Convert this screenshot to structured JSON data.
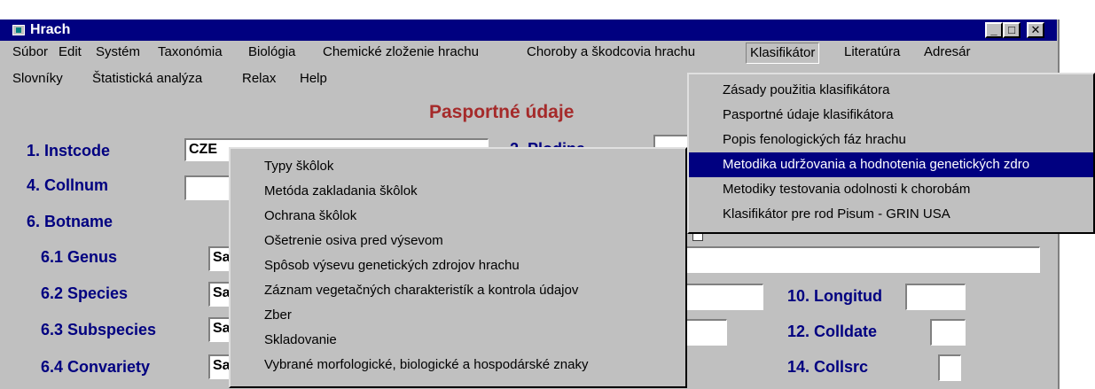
{
  "window": {
    "title": "Hrach",
    "min_glyph": "_",
    "max_glyph": "□",
    "close_glyph": "✕"
  },
  "menubar": {
    "row1": [
      "Súbor",
      "Edit",
      "Systém",
      "Taxonómia",
      "Biológia",
      "Chemické zloženie hrachu",
      "Choroby a škodcovia hrachu",
      "Klasifikátor",
      "Literatúra",
      "Adresár"
    ],
    "row2": [
      "Slovníky",
      "Štatistická analýza",
      "Relax",
      "Help"
    ]
  },
  "form": {
    "title": "Pasportné údaje",
    "labels": {
      "instcode": "1. Instcode",
      "plodina": "2. Plodina",
      "collnum": "4. Collnum",
      "botname": "6. Botname",
      "genus": "6.1 Genus",
      "species": "6.2 Species",
      "subspecies": "6.3 Subspecies",
      "convariety": "6.4 Convariety",
      "longitud": "10. Longitud",
      "colldate": "12. Colldate",
      "collsrc": "14. Collsrc"
    },
    "values": {
      "instcode": "CZE",
      "genus": "Sa",
      "species": "Sa",
      "subspecies": "Sa",
      "convariety": "Sa"
    }
  },
  "klasifikator_menu": [
    "Zásady použitia klasifikátora",
    "Pasportné údaje klasifikátora",
    "Popis fenologických fáz hrachu",
    "Metodika udržovania a hodnotenia genetických zdro",
    "Metodiky testovania odolnosti k chorobám",
    "Klasifikátor pre rod Pisum - GRIN USA"
  ],
  "metodika_submenu": [
    "Typy škôlok",
    "Metóda zakladania škôlok",
    "Ochrana škôlok",
    "Ošetrenie osiva pred výsevom",
    "Spôsob výsevu genetických zdrojov hrachu",
    "Záznam vegetačných charakteristík a kontrola údajov",
    "Zber",
    "Skladovanie",
    "Vybrané morfologické, biologické a hospodárské znaky"
  ],
  "colors": {
    "titlebar": "#000080",
    "face": "#c0c0c0",
    "label": "#000080",
    "form_title": "#a52a2a",
    "highlight": "#000080"
  },
  "icons": [
    "app-icon",
    "minimize-icon",
    "maximize-icon",
    "close-icon"
  ]
}
